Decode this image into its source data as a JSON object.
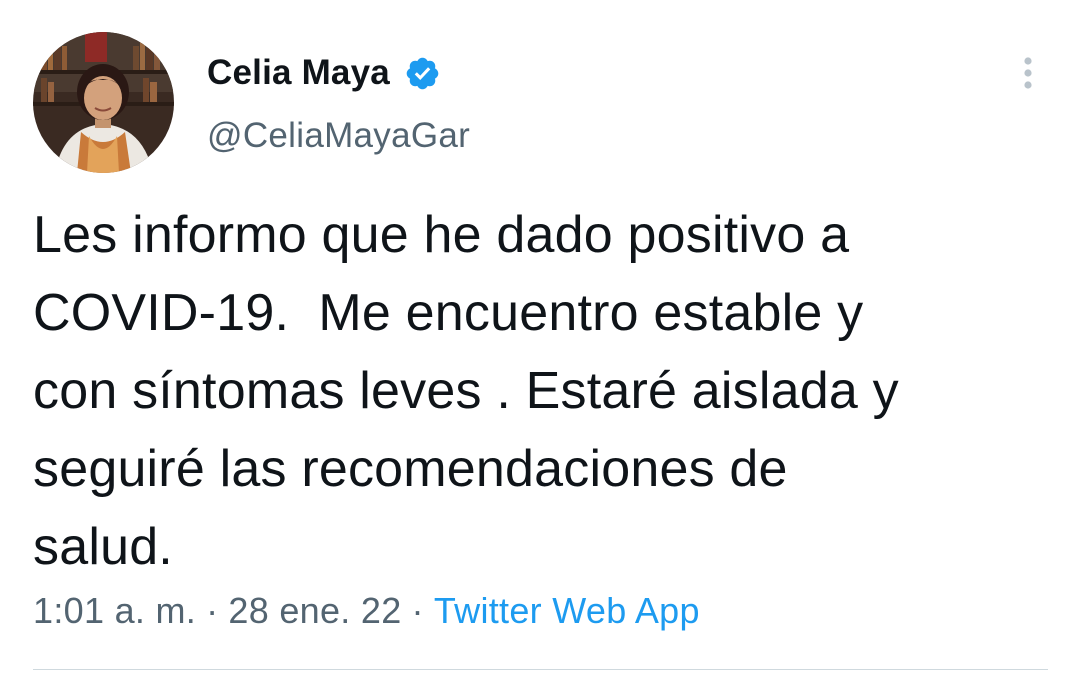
{
  "author": {
    "display_name": "Celia Maya",
    "handle": "@CeliaMayaGar",
    "verified": true
  },
  "tweet": {
    "text": "Les informo que he dado positivo a\nCOVID-19.  Me encuentro estable y\ncon síntomas leves . Estaré aislada y\nseguiré las recomendaciones de\nsalud."
  },
  "meta": {
    "time": "1:01 a. m.",
    "separator": "·",
    "date": "28 ene. 22",
    "source": "Twitter Web App"
  },
  "icons": {
    "verified": "verified-badge-icon",
    "more": "more-options-icon"
  },
  "colors": {
    "text": "#0f1419",
    "secondary": "#536471",
    "accent": "#1d9bf0",
    "divider": "#cfd9de"
  }
}
